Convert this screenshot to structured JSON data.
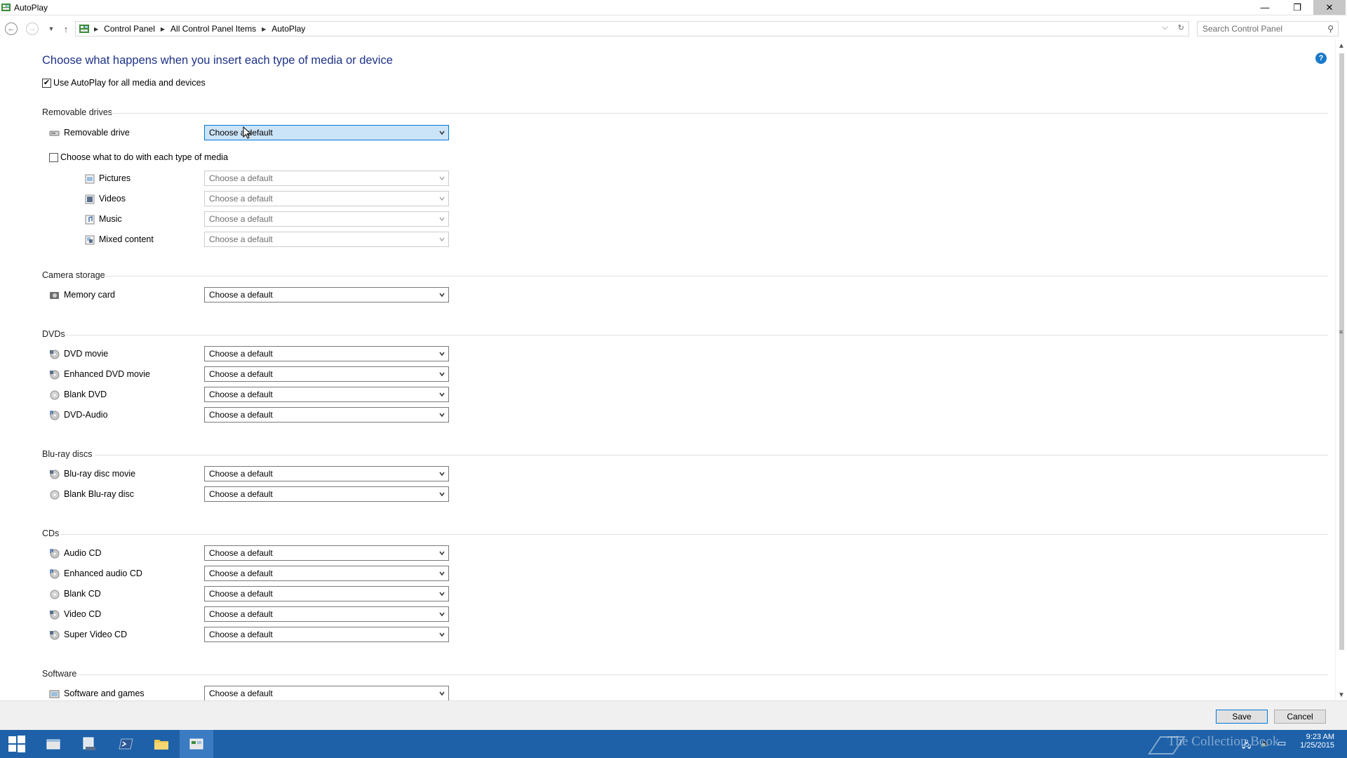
{
  "window": {
    "title": "AutoPlay",
    "minimize_glyph": "—",
    "maximize_glyph": "❐",
    "close_glyph": "✕"
  },
  "address_bar": {
    "breadcrumbs": [
      "Control Panel",
      "All Control Panel Items",
      "AutoPlay"
    ],
    "search_placeholder": "Search Control Panel"
  },
  "page": {
    "heading": "Choose what happens when you insert each type of media or device",
    "help_glyph": "?",
    "use_autoplay_label": "Use AutoPlay for all media and devices",
    "use_autoplay_checked": true,
    "each_media_label": "Choose what to do with each type of media",
    "each_media_checked": false
  },
  "sections": {
    "removable": {
      "title": "Removable drives",
      "drive_label": "Removable drive",
      "drive_value": "Choose a default",
      "media": [
        {
          "label": "Pictures",
          "value": "Choose a default"
        },
        {
          "label": "Videos",
          "value": "Choose a default"
        },
        {
          "label": "Music",
          "value": "Choose a default"
        },
        {
          "label": "Mixed content",
          "value": "Choose a default"
        }
      ]
    },
    "camera": {
      "title": "Camera storage",
      "items": [
        {
          "label": "Memory card",
          "value": "Choose a default"
        }
      ]
    },
    "dvds": {
      "title": "DVDs",
      "items": [
        {
          "label": "DVD movie",
          "value": "Choose a default"
        },
        {
          "label": "Enhanced DVD movie",
          "value": "Choose a default"
        },
        {
          "label": "Blank DVD",
          "value": "Choose a default"
        },
        {
          "label": "DVD-Audio",
          "value": "Choose a default"
        }
      ]
    },
    "bluray": {
      "title": "Blu-ray discs",
      "items": [
        {
          "label": "Blu-ray disc movie",
          "value": "Choose a default"
        },
        {
          "label": "Blank Blu-ray disc",
          "value": "Choose a default"
        }
      ]
    },
    "cds": {
      "title": "CDs",
      "items": [
        {
          "label": "Audio CD",
          "value": "Choose a default"
        },
        {
          "label": "Enhanced audio CD",
          "value": "Choose a default"
        },
        {
          "label": "Blank CD",
          "value": "Choose a default"
        },
        {
          "label": "Video CD",
          "value": "Choose a default"
        },
        {
          "label": "Super Video CD",
          "value": "Choose a default"
        }
      ]
    },
    "software": {
      "title": "Software",
      "items": [
        {
          "label": "Software and games",
          "value": "Choose a default"
        }
      ]
    }
  },
  "footer": {
    "save_label": "Save",
    "cancel_label": "Cancel"
  },
  "taskbar": {
    "time": "9:23 AM",
    "date": "1/25/2015",
    "watermark": "The Collection Book"
  },
  "colors": {
    "heading": "#1e3287",
    "taskbar": "#1e61a8",
    "accent": "#0078d7"
  }
}
